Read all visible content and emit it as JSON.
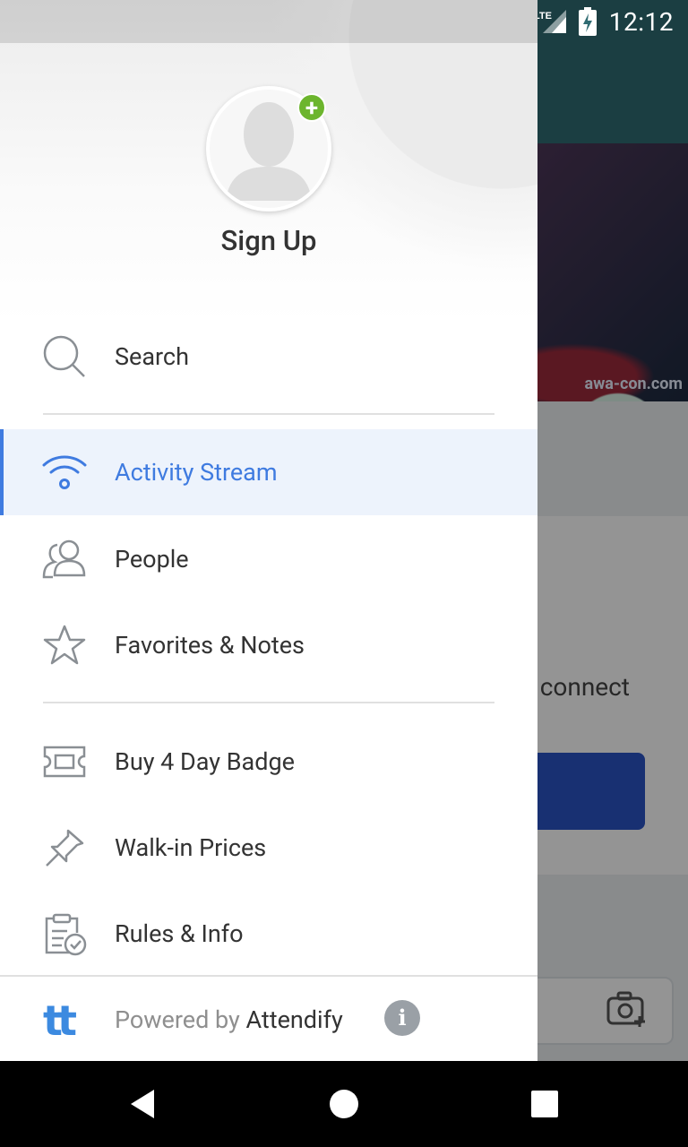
{
  "status_bar": {
    "time": "12:12",
    "network": "LTE"
  },
  "drawer": {
    "profile": {
      "signup_label": "Sign Up"
    },
    "search_label": "Search",
    "items": [
      {
        "label": "Activity Stream",
        "icon": "wifi-icon",
        "active": true
      },
      {
        "label": "People",
        "icon": "people-icon"
      },
      {
        "label": "Favorites & Notes",
        "icon": "star-icon"
      }
    ],
    "extra_items": [
      {
        "label": "Buy 4 Day Badge",
        "icon": "ticket-icon"
      },
      {
        "label": "Walk-in Prices",
        "icon": "pin-icon"
      },
      {
        "label": "Rules & Info",
        "icon": "clipboard-check-icon"
      }
    ],
    "footer": {
      "logo_text": "tt",
      "powered_by": "Powered by",
      "brand": "Attendify"
    }
  },
  "background": {
    "banner_text": "awa-con.com",
    "card_text": "d connect"
  },
  "colors": {
    "accent": "#3f7be0",
    "active_bg": "#edf3fc",
    "add_badge": "#6cb52d",
    "appbar": "#2f6b72"
  }
}
